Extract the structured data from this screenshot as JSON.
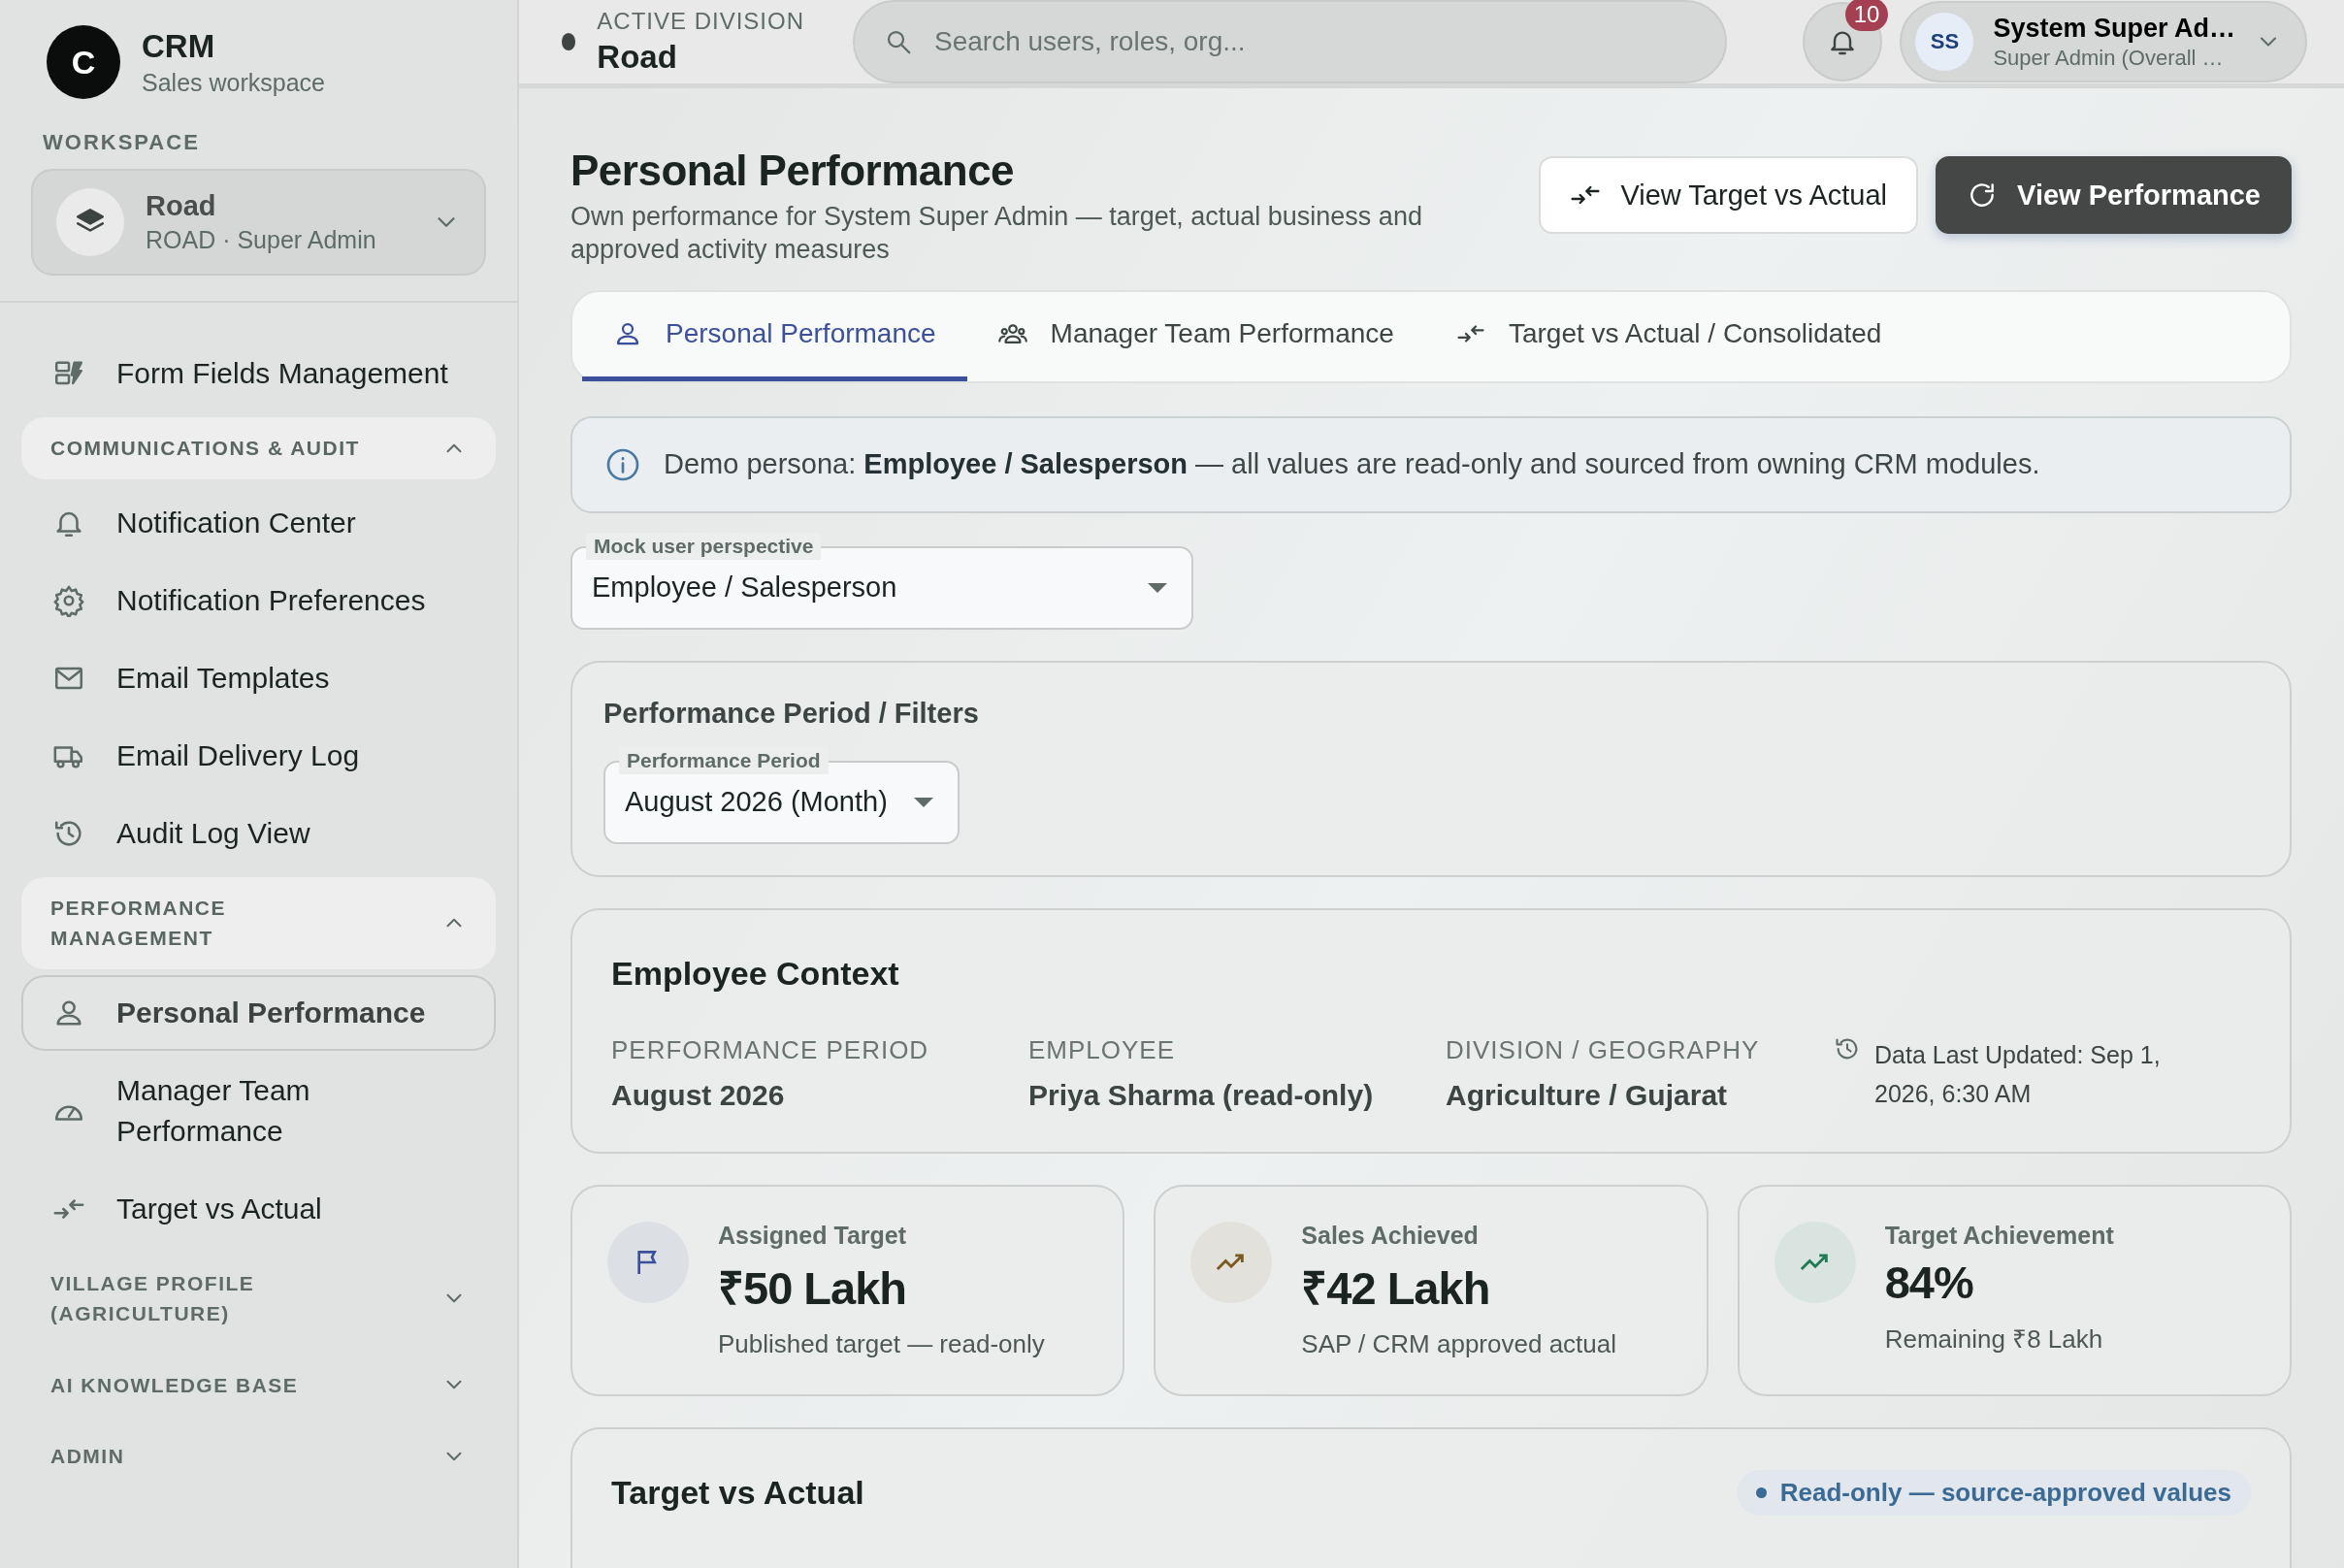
{
  "brand": {
    "initial": "C",
    "name": "CRM",
    "subtitle": "Sales workspace"
  },
  "workspace": {
    "label": "WORKSPACE",
    "name": "Road",
    "detail": "ROAD · Super Admin"
  },
  "nav": [
    {
      "kind": "item",
      "label": "Form Fields Management",
      "selected": false
    },
    {
      "kind": "section",
      "label": "COMMUNICATIONS & AUDIT",
      "expanded": true,
      "children": [
        {
          "label": "Notification Center",
          "selected": false
        },
        {
          "label": "Notification Preferences",
          "selected": false
        },
        {
          "label": "Email Templates",
          "selected": false
        },
        {
          "label": "Email Delivery Log",
          "selected": false
        },
        {
          "label": "Audit Log View",
          "selected": false
        }
      ]
    },
    {
      "kind": "section",
      "label": "PERFORMANCE MANAGEMENT",
      "expanded": true,
      "children": [
        {
          "label": "Personal Performance",
          "selected": true
        },
        {
          "label": "Manager Team Performance",
          "selected": false
        },
        {
          "label": "Target vs Actual",
          "selected": false
        }
      ]
    },
    {
      "kind": "section",
      "label": "VILLAGE PROFILE (AGRICULTURE)",
      "expanded": false
    },
    {
      "kind": "section",
      "label": "AI KNOWLEDGE BASE",
      "expanded": false
    },
    {
      "kind": "section",
      "label": "ADMIN",
      "expanded": false
    }
  ],
  "header": {
    "division_label": "ACTIVE DIVISION",
    "division": "Road",
    "search": {
      "placeholder": "Search users, roles, org..."
    },
    "notifications": "10",
    "user": {
      "initials": "SS",
      "name": "System Super Ad…",
      "role": "Super Admin (Overall …"
    }
  },
  "page": {
    "title": "Personal Performance",
    "subtitle": "Own performance for System Super Admin — target, actual business and approved activity measures",
    "actions": [
      {
        "kind": "secondary",
        "label": "View Target vs Actual"
      },
      {
        "kind": "primary",
        "label": "View Performance"
      }
    ]
  },
  "tabs": [
    {
      "label": "Personal Performance",
      "selected": true
    },
    {
      "label": "Manager Team Performance",
      "selected": false
    },
    {
      "label": "Target vs Actual / Consolidated",
      "selected": false
    }
  ],
  "notice": {
    "text": "Demo persona: **Employee / Salesperson** — all values are read-only and sourced from owning CRM modules."
  },
  "perspective": {
    "label": "Mock user perspective",
    "value": "Employee / Salesperson"
  },
  "filters": {
    "title": "Performance Period / Filters",
    "period": {
      "label": "Performance Period",
      "value": "August 2026 (Month)"
    }
  },
  "context": {
    "title": "Employee Context",
    "fields": [
      {
        "label": "PERFORMANCE PERIOD",
        "value": "August 2026"
      },
      {
        "label": "EMPLOYEE",
        "value": "Priya Sharma (read-only)"
      },
      {
        "label": "DIVISION / GEOGRAPHY",
        "value": "Agriculture / Gujarat"
      }
    ],
    "updated": "Data Last Updated: Sep 1, 2026, 6:30 AM"
  },
  "kpis": [
    {
      "label": "Assigned Target",
      "value": "₹50 Lakh",
      "note": "Published target — read-only",
      "color": "#3b4f9a"
    },
    {
      "label": "Sales Achieved",
      "value": "₹42 Lakh",
      "note": "SAP / CRM approved actual",
      "color": "#7a5a1e"
    },
    {
      "label": "Target Achievement",
      "value": "84%",
      "note": "Remaining ₹8 Lakh",
      "color": "#1f7a55"
    }
  ],
  "target_section": {
    "title": "Target vs Actual",
    "badge": "Read-only — source-approved values"
  }
}
